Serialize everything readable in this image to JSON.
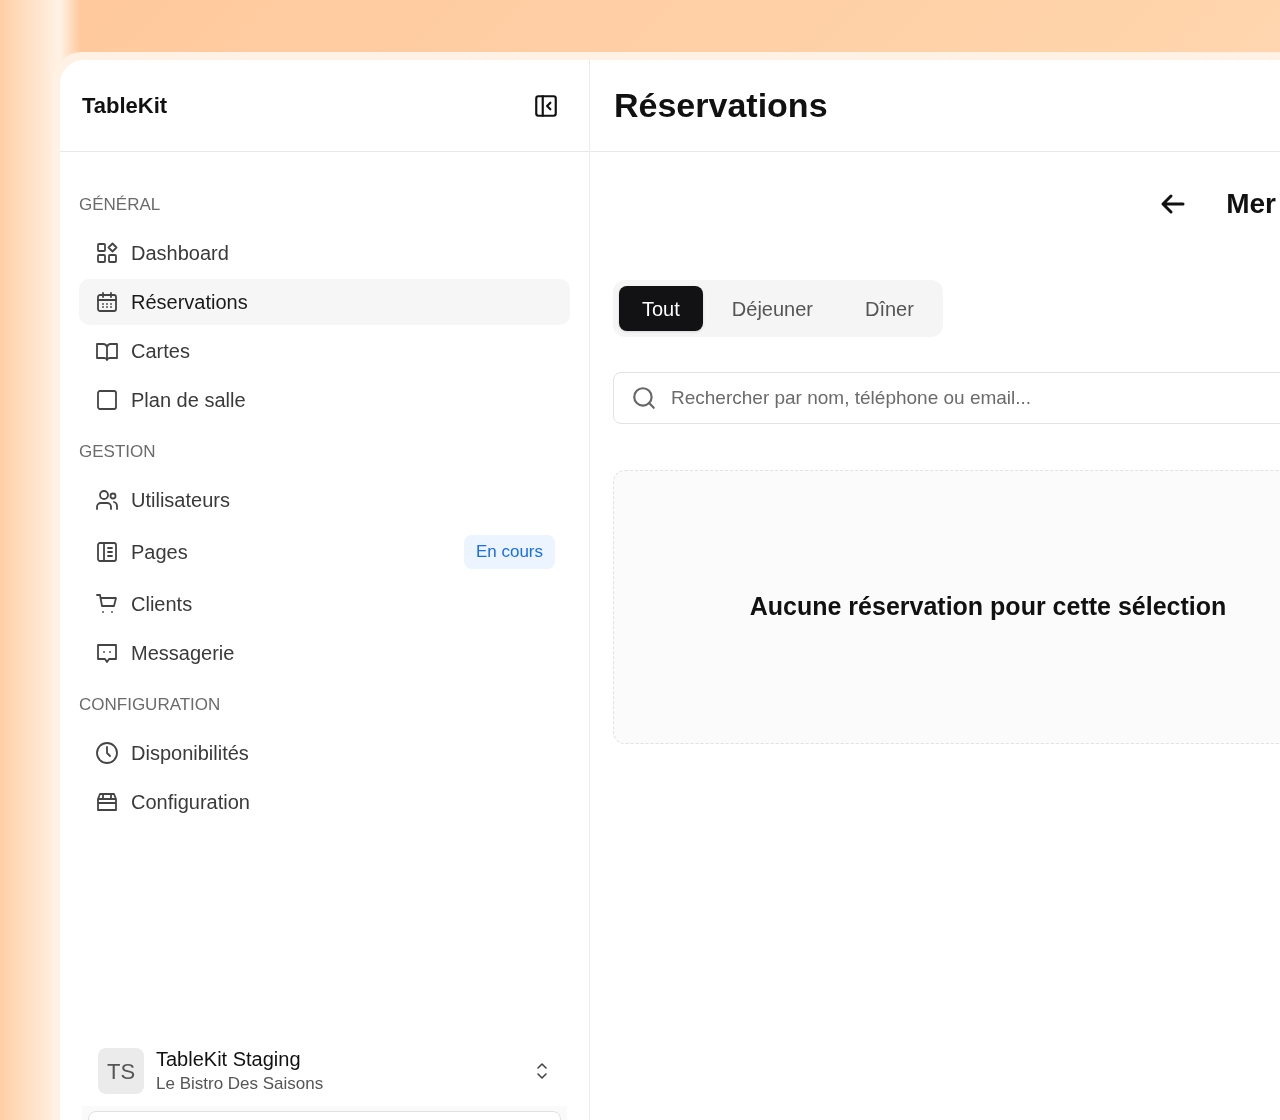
{
  "sidebar": {
    "brand": "TableKit",
    "sections": [
      {
        "title": "GÉNÉRAL",
        "items": [
          {
            "label": "Dashboard",
            "selected": false
          },
          {
            "label": "Réservations",
            "selected": true
          },
          {
            "label": "Cartes",
            "selected": false
          },
          {
            "label": "Plan de salle",
            "selected": false
          }
        ]
      },
      {
        "title": "GESTION",
        "items": [
          {
            "label": "Utilisateurs",
            "selected": false
          },
          {
            "label": "Pages",
            "selected": false,
            "badge": "En cours"
          },
          {
            "label": "Clients",
            "selected": false
          },
          {
            "label": "Messagerie",
            "selected": false
          }
        ]
      },
      {
        "title": "CONFIGURATION",
        "items": [
          {
            "label": "Disponibilités",
            "selected": false
          },
          {
            "label": "Configuration",
            "selected": false
          }
        ]
      }
    ],
    "account": {
      "initials": "TS",
      "name": "TableKit Staging",
      "subtitle": "Le Bistro Des Saisons"
    }
  },
  "main": {
    "title": "Réservations",
    "nav_label": "Mer",
    "tabs": [
      {
        "label": "Tout",
        "selected": true
      },
      {
        "label": "Déjeuner",
        "selected": false
      },
      {
        "label": "Dîner",
        "selected": false
      }
    ],
    "search": {
      "placeholder": "Rechercher par nom, téléphone ou email..."
    },
    "empty_message": "Aucune réservation pour cette sélection"
  }
}
